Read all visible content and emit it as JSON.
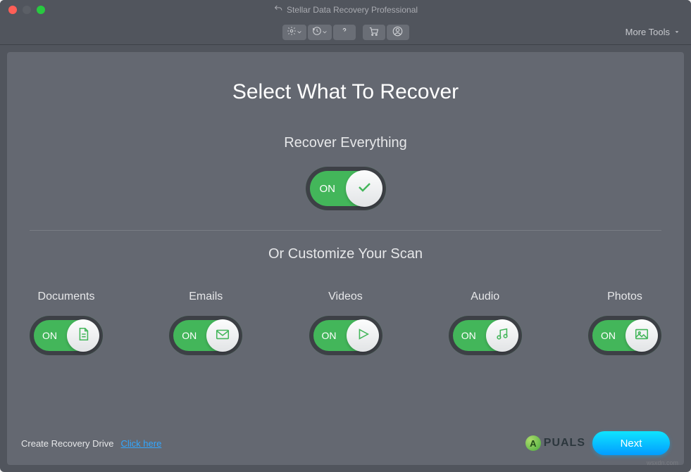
{
  "window": {
    "title": "Stellar Data Recovery Professional"
  },
  "toolbar": {
    "more_tools": "More Tools"
  },
  "main": {
    "title": "Select What To Recover",
    "recover_everything": "Recover Everything",
    "customize": "Or Customize Your Scan",
    "toggle_on": "ON",
    "categories": [
      {
        "label": "Documents",
        "state": "ON",
        "icon": "document-icon"
      },
      {
        "label": "Emails",
        "state": "ON",
        "icon": "email-icon"
      },
      {
        "label": "Videos",
        "state": "ON",
        "icon": "video-icon"
      },
      {
        "label": "Audio",
        "state": "ON",
        "icon": "audio-icon"
      },
      {
        "label": "Photos",
        "state": "ON",
        "icon": "photo-icon"
      }
    ]
  },
  "footer": {
    "create_drive": "Create Recovery Drive",
    "click_here": "Click here",
    "next": "Next"
  },
  "watermark": {
    "text": "PUALS",
    "badge": "A",
    "url": "wsxdn.com"
  }
}
